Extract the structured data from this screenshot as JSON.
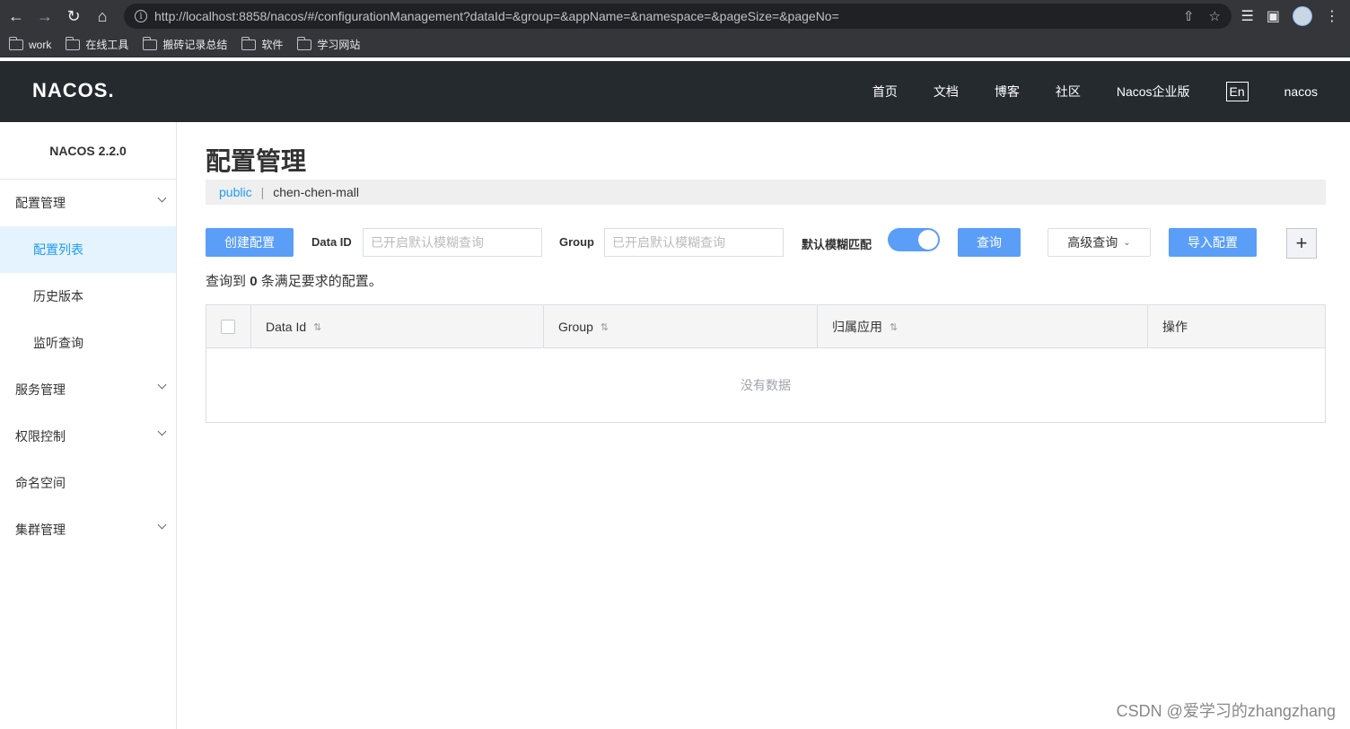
{
  "browser": {
    "url": "http://localhost:8858/nacos/#/configurationManagement?dataId=&group=&appName=&namespace=&pageSize=&pageNo=",
    "bookmarks": [
      "work",
      "在线工具",
      "搬砖记录总结",
      "软件",
      "学习网站"
    ]
  },
  "header": {
    "logo": "NACOS.",
    "nav": [
      "首页",
      "文档",
      "博客",
      "社区",
      "Nacos企业版"
    ],
    "lang": "En",
    "user": "nacos"
  },
  "sidebar": {
    "version": "NACOS 2.2.0",
    "config_mgmt": "配置管理",
    "config_list": "配置列表",
    "history": "历史版本",
    "listen_query": "监听查询",
    "service_mgmt": "服务管理",
    "permission": "权限控制",
    "namespace": "命名空间",
    "cluster": "集群管理"
  },
  "main": {
    "title": "配置管理",
    "namespace_public": "public",
    "namespace_sep": "|",
    "namespace_current": "chen-chen-mall",
    "create_btn": "创建配置",
    "dataid_label": "Data ID",
    "dataid_placeholder": "已开启默认模糊查询",
    "group_label": "Group",
    "group_placeholder": "已开启默认模糊查询",
    "fuzzy_label": "默认模糊匹配",
    "fuzzy_on": true,
    "query_btn": "查询",
    "advanced_btn": "高级查询",
    "import_btn": "导入配置",
    "plus": "+",
    "result_prefix": "查询到",
    "result_count": "0",
    "result_suffix": "条满足要求的配置。",
    "columns": [
      "Data Id",
      "Group",
      "归属应用",
      "操作"
    ],
    "empty_text": "没有数据"
  },
  "watermark": "CSDN @爱学习的zhangzhang",
  "colors": {
    "accent": "#209bfa",
    "primary_btn": "#5a9ef8",
    "header_bg": "#252a2f"
  }
}
